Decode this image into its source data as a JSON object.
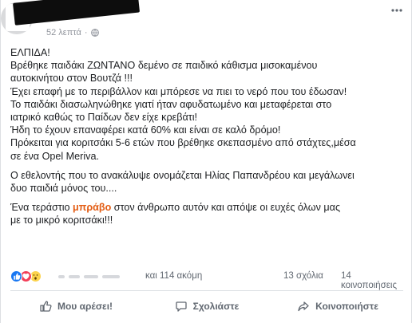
{
  "post": {
    "timestamp": "52 λεπτά",
    "separator": "·",
    "privacy_icon": "globe-icon",
    "menu_icon": "more-options-icon",
    "paragraphs": [
      [
        "ΕΛΠΙΔΑ!"
      ],
      [
        "Βρέθηκε παιδάκι ΖΩΝΤΑΝΟ δεμένο σε παιδικό κάθισμα μισοκαμένου",
        "αυτοκινήτου στον Βουτζά !!!"
      ],
      [
        "Έχει επαφή με το περιβάλλον και μπόρεσε να πιει το νερό που του έδωσαν!"
      ],
      [
        "Το παιδάκι διασωληνώθηκε γιατί ήταν αφυδατωμένο και μεταφέρεται στο",
        "ιατρικό καθώς το Παίδων δεν είχε κρεβάτι!"
      ],
      [
        "Ήδη το έχουν επαναφέρει κατά 60% και είναι σε καλό δρόμο!"
      ],
      [
        "Πρόκειται για κοριτσάκι 5-6 ετών που βρέθηκε σκεπασμένο από στάχτες,μέσα",
        "σε ένα Opel Meriva."
      ],
      [
        "Ο εθελοντής που το ανακάλυψε ονομάζεται Ηλίας Παπανδρέου και μεγάλωνει",
        "δυο παιδιά μόνος του...."
      ],
      {
        "before": "Ένα τεράστιο ",
        "accent": "μπράβο",
        "after": " στον άνθρωπο αυτόν και απόψε οι ευχές όλων μας",
        "line2": "με το μικρό κοριτσάκι!!!"
      }
    ],
    "accent_color": "#e35d14"
  },
  "stats": {
    "reaction_icons": [
      "like-icon",
      "love-icon",
      "wow-icon"
    ],
    "reactors_text": "και 114 ακόμη",
    "comments_text": "13 σχόλια",
    "shares_text": "14 κοινοποιήσεις"
  },
  "actions": {
    "like_label": "Μου αρέσει!",
    "comment_label": "Σχολιάστε",
    "share_label": "Κοινοποιήστε"
  },
  "colors": {
    "like_blue": "#1877f2",
    "love_red": "#f33e58",
    "wow_yellow": "#fcd34d",
    "meta_gray": "#90949c",
    "action_gray": "#606770"
  }
}
